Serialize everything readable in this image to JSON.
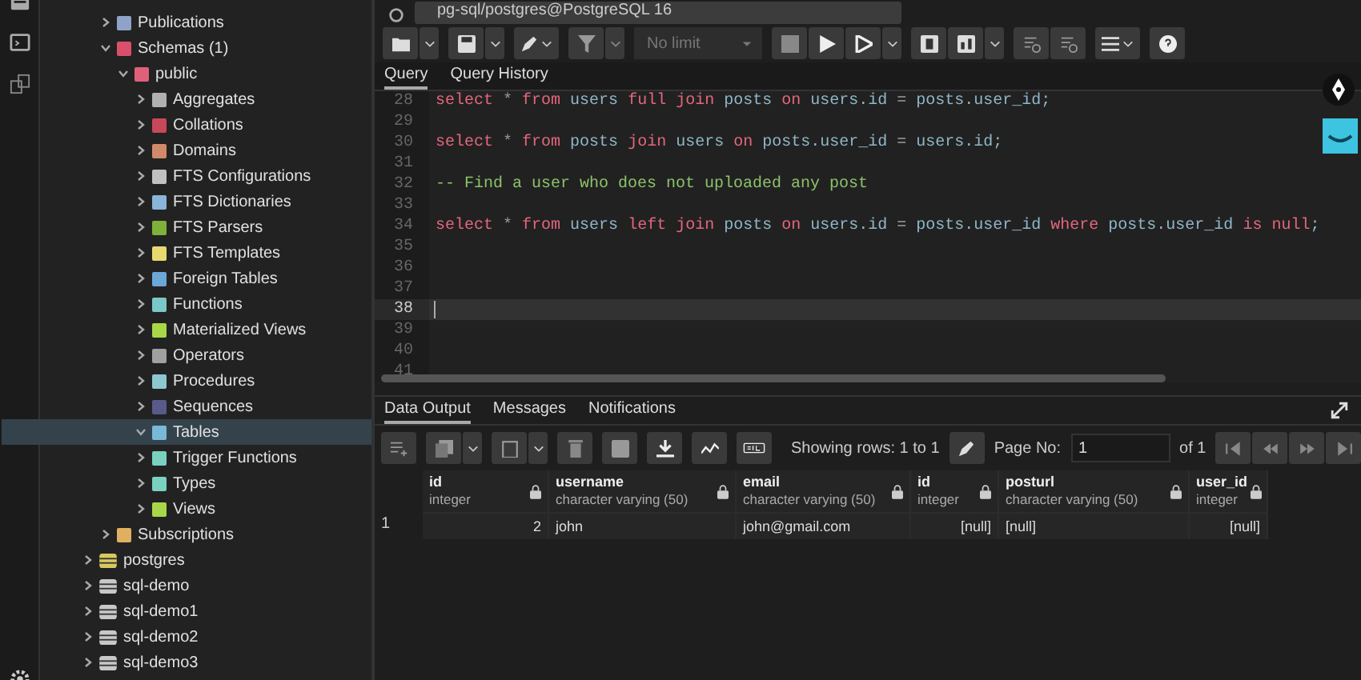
{
  "connection": {
    "title": "pg-sql/postgres@PostgreSQL 16"
  },
  "database_objects": [
    {
      "label": "Publications",
      "color": "#8fa3c8",
      "expanded": false,
      "selected": false
    },
    {
      "label": "Schemas (1)",
      "color": "#d9506a",
      "expanded": true,
      "selected": false,
      "children": [
        {
          "label": "public",
          "color": "#e0607a",
          "expanded": true,
          "selected": false,
          "children": [
            {
              "label": "Aggregates",
              "color": "#b0b0b0",
              "expanded": false,
              "selected": false
            },
            {
              "label": "Collations",
              "color": "#c8485a",
              "expanded": false,
              "selected": false
            },
            {
              "label": "Domains",
              "color": "#d08a6a",
              "expanded": false,
              "selected": false
            },
            {
              "label": "FTS Configurations",
              "color": "#c0c0c0",
              "expanded": false,
              "selected": false
            },
            {
              "label": "FTS Dictionaries",
              "color": "#8ab4d8",
              "expanded": false,
              "selected": false
            },
            {
              "label": "FTS Parsers",
              "color": "#7fb03a",
              "expanded": false,
              "selected": false
            },
            {
              "label": "FTS Templates",
              "color": "#e8d870",
              "expanded": false,
              "selected": false
            },
            {
              "label": "Foreign Tables",
              "color": "#6aa8d8",
              "expanded": false,
              "selected": false
            },
            {
              "label": "Functions",
              "color": "#7ac8c8",
              "expanded": false,
              "selected": false
            },
            {
              "label": "Materialized Views",
              "color": "#a8d848",
              "expanded": false,
              "selected": false
            },
            {
              "label": "Operators",
              "color": "#a0a0a0",
              "expanded": false,
              "selected": false
            },
            {
              "label": "Procedures",
              "color": "#8cc8d0",
              "expanded": false,
              "selected": false
            },
            {
              "label": "Sequences",
              "color": "#5a5a8a",
              "expanded": false,
              "selected": false
            },
            {
              "label": "Tables",
              "color": "#7ab8d8",
              "expanded": true,
              "selected": true
            },
            {
              "label": "Trigger Functions",
              "color": "#7ad0c0",
              "expanded": false,
              "selected": false
            },
            {
              "label": "Types",
              "color": "#7ad0c1",
              "expanded": false,
              "selected": false
            },
            {
              "label": "Views",
              "color": "#a8d849",
              "expanded": false,
              "selected": false
            }
          ]
        }
      ]
    },
    {
      "label": "Subscriptions",
      "color": "#e0b060",
      "expanded": false,
      "selected": false
    }
  ],
  "databases": [
    {
      "label": "postgres",
      "color": "#d8c860",
      "expanded": false
    },
    {
      "label": "sql-demo",
      "color": "#c8c8c8",
      "expanded": false
    },
    {
      "label": "sql-demo1",
      "color": "#c8c8c8",
      "expanded": false
    },
    {
      "label": "sql-demo2",
      "color": "#c8c8c8",
      "expanded": false
    },
    {
      "label": "sql-demo3",
      "color": "#c8c8c8",
      "expanded": false
    }
  ],
  "toolbar": {
    "limit_placeholder": "No limit"
  },
  "editor_tabs": [
    {
      "label": "Query",
      "selected": true
    },
    {
      "label": "Query History",
      "selected": false
    }
  ],
  "code_lines": [
    {
      "number": "28",
      "cursor": false,
      "tokens": [
        {
          "kind": "keyword",
          "text": "select"
        },
        {
          "kind": "op",
          "text": " * "
        },
        {
          "kind": "keyword",
          "text": "from"
        },
        {
          "kind": "ident",
          "text": " users "
        },
        {
          "kind": "keyword",
          "text": "full join"
        },
        {
          "kind": "ident",
          "text": " posts "
        },
        {
          "kind": "keyword",
          "text": "on"
        },
        {
          "kind": "ident",
          "text": " users.id "
        },
        {
          "kind": "op",
          "text": "="
        },
        {
          "kind": "ident",
          "text": " posts.user_id;"
        }
      ]
    },
    {
      "number": "29",
      "cursor": false
    },
    {
      "number": "30",
      "cursor": false,
      "tokens": [
        {
          "kind": "keyword",
          "text": "select"
        },
        {
          "kind": "op",
          "text": " * "
        },
        {
          "kind": "keyword",
          "text": "from"
        },
        {
          "kind": "ident",
          "text": " posts "
        },
        {
          "kind": "keyword",
          "text": "join"
        },
        {
          "kind": "ident",
          "text": " users "
        },
        {
          "kind": "keyword",
          "text": "on"
        },
        {
          "kind": "ident",
          "text": " posts.user_id "
        },
        {
          "kind": "op",
          "text": "="
        },
        {
          "kind": "ident",
          "text": " users.id;"
        }
      ]
    },
    {
      "number": "31",
      "cursor": false
    },
    {
      "number": "32",
      "cursor": false,
      "tokens": [
        {
          "kind": "comment",
          "text": "-- Find a user who does not uploaded any post"
        }
      ]
    },
    {
      "number": "33",
      "cursor": false
    },
    {
      "number": "34",
      "cursor": false,
      "tokens": [
        {
          "kind": "keyword",
          "text": "select"
        },
        {
          "kind": "op",
          "text": " * "
        },
        {
          "kind": "keyword",
          "text": "from"
        },
        {
          "kind": "ident",
          "text": " users "
        },
        {
          "kind": "keyword",
          "text": "left join"
        },
        {
          "kind": "ident",
          "text": " posts "
        },
        {
          "kind": "keyword",
          "text": "on"
        },
        {
          "kind": "ident",
          "text": " users.id "
        },
        {
          "kind": "op",
          "text": "="
        },
        {
          "kind": "ident",
          "text": " posts.user_id "
        },
        {
          "kind": "keyword",
          "text": "where"
        },
        {
          "kind": "ident",
          "text": " posts.user_id "
        },
        {
          "kind": "keyword",
          "text": "is null"
        },
        {
          "kind": "ident",
          "text": ";"
        }
      ]
    },
    {
      "number": "35",
      "cursor": false
    },
    {
      "number": "36",
      "cursor": false
    },
    {
      "number": "37",
      "cursor": false
    },
    {
      "number": "38",
      "cursor": true
    },
    {
      "number": "39",
      "cursor": false
    },
    {
      "number": "40",
      "cursor": false
    },
    {
      "number": "41",
      "cursor": false
    }
  ],
  "result_tabs": [
    {
      "label": "Data Output",
      "selected": true
    },
    {
      "label": "Messages",
      "selected": false
    },
    {
      "label": "Notifications",
      "selected": false
    }
  ],
  "pager": {
    "showing": "Showing rows: 1 to 1",
    "page_label": "Page No:",
    "page": "1",
    "of": "of 1"
  },
  "result_columns": [
    {
      "name": "id",
      "type": "integer",
      "kind": "number"
    },
    {
      "name": "username",
      "type": "character varying (50)",
      "kind": "text"
    },
    {
      "name": "email",
      "type": "character varying (50)",
      "kind": "text"
    },
    {
      "name": "id",
      "type": "integer",
      "kind": "number"
    },
    {
      "name": "posturl",
      "type": "character varying (50)",
      "kind": "text"
    },
    {
      "name": "user_id",
      "type": "integer",
      "kind": "number"
    }
  ],
  "result_rows": [
    {
      "number": "1",
      "cells": [
        "2",
        "john",
        "john@gmail.com",
        "[null]",
        "[null]",
        "[null]"
      ]
    }
  ]
}
